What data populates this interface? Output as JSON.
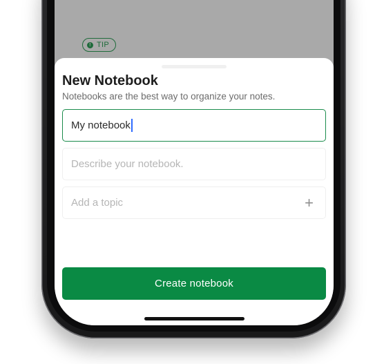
{
  "background": {
    "tip_label": "TIP",
    "tip_icon": "info-icon"
  },
  "sheet": {
    "title": "New Notebook",
    "subtitle": "Notebooks are the best way to organize your notes.",
    "name_input": {
      "value": "My notebook"
    },
    "description_input": {
      "placeholder": "Describe your notebook."
    },
    "topic_input": {
      "placeholder": "Add a topic",
      "add_icon": "plus-icon"
    },
    "create_button_label": "Create notebook"
  },
  "colors": {
    "accent": "#0a8a44",
    "focus_border": "#1a8b4b",
    "caret": "#2f6bff"
  }
}
